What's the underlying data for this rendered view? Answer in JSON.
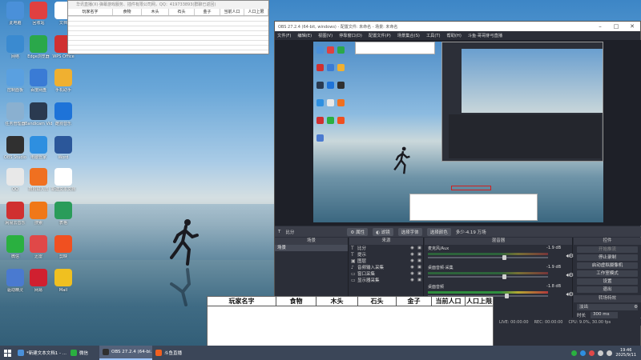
{
  "desktop": {
    "icons": [
      {
        "label": "此电脑",
        "color": "#4a90d9"
      },
      {
        "label": "回收站",
        "color": "#e04040"
      },
      {
        "label": "文档",
        "color": "#ffffff"
      },
      {
        "label": "网络",
        "color": "#3a8ad0"
      },
      {
        "label": "Edge浏览器",
        "color": "#2aa84a"
      },
      {
        "label": "WPS Office",
        "color": "#d03030"
      },
      {
        "label": "控制面板",
        "color": "#5aa0e0"
      },
      {
        "label": "百度网盘",
        "color": "#3a7bd5"
      },
      {
        "label": "手机助手",
        "color": "#f0b030"
      },
      {
        "label": "任务管理器",
        "color": "#8ab0d0"
      },
      {
        "label": "Bandicam Video Editor",
        "color": "#2a3a50"
      },
      {
        "label": "酷狗音乐",
        "color": "#1e73d8"
      },
      {
        "label": "OBS Studio",
        "color": "#303030"
      },
      {
        "label": "电脑管家",
        "color": "#2e8fe0"
      },
      {
        "label": "Word",
        "color": "#2b579a"
      },
      {
        "label": "QQ",
        "color": "#e8e8e8"
      },
      {
        "label": "搜狗输入法",
        "color": "#f07020"
      },
      {
        "label": "新建文本文档",
        "color": "#ffffff"
      },
      {
        "label": "网易云音乐",
        "color": "#d03030"
      },
      {
        "label": "搜索",
        "color": "#f07818"
      },
      {
        "label": "表格",
        "color": "#2a9c5a"
      },
      {
        "label": "微信",
        "color": "#2ab040"
      },
      {
        "label": "迅雷",
        "color": "#e04848"
      },
      {
        "label": "剪映",
        "color": "#f05020"
      },
      {
        "label": "驱动精灵",
        "color": "#4a7ad0"
      },
      {
        "label": "网易",
        "color": "#d02030"
      },
      {
        "label": "Mail",
        "color": "#f0c020"
      }
    ]
  },
  "sheet_window": {
    "title": "华讯直播(X)·弹幕游戏服务、插件有限公司网，QQ：419733893(群聊已返回)",
    "columns": [
      "玩家名字",
      "食物",
      "木头",
      "石头",
      "金子",
      "当前人口",
      "人口上限"
    ]
  },
  "obs": {
    "title": "OBS 27.2.4 (64-bit, windows) - 配置文件: 未命名 - 场景: 未命名",
    "window_buttons": {
      "minimize": "–",
      "maximize": "□",
      "close": "✕"
    },
    "menu": [
      "文件(F)",
      "编辑(E)",
      "视图(V)",
      "停靠窗口(D)",
      "配置文件(P)",
      "场景集合(S)",
      "工具(T)",
      "帮助(H)",
      "斗鱼·哥哥芽弓直播"
    ],
    "source_toolbar": {
      "current_source": "比分",
      "properties": "属性",
      "filters": "滤镜",
      "select_font": "选择字体",
      "select_color": "选择颜色",
      "text_content": "多少-4.19 万场"
    },
    "scenes": {
      "header": "场景",
      "items": [
        "场景"
      ]
    },
    "sources": {
      "header": "来源",
      "items": [
        {
          "icon": "T",
          "label": "比分"
        },
        {
          "icon": "T",
          "label": "提示"
        },
        {
          "icon": "▣",
          "label": "图层"
        },
        {
          "icon": "♪",
          "label": "音频输入采集"
        },
        {
          "icon": "▭",
          "label": "窗口采集"
        },
        {
          "icon": "▭",
          "label": "显示器采集"
        }
      ]
    },
    "mixer": {
      "header": "混音器",
      "channels": [
        {
          "name": "麦克风/Aux",
          "db": "-1.9 dB",
          "level": 0.0,
          "volume": 0.62
        },
        {
          "name": "桌面音频·采集",
          "db": "-1.9 dB",
          "level": 0.0,
          "volume": 0.62
        },
        {
          "name": "桌面音频",
          "db": "-1.8 dB",
          "level": 0.68,
          "volume": 0.64
        }
      ]
    },
    "controls": {
      "header": "控件",
      "buttons": [
        "开始推流",
        "停止录制",
        "启动虚拟摄像机",
        "工作室模式",
        "设置",
        "退出"
      ]
    },
    "transitions": {
      "header": "转场特效",
      "selected": "淡出",
      "duration_label": "时长",
      "duration_value": "300 ms"
    },
    "status": {
      "live": "LIVE: 00:00:00",
      "rec": "REC: 00:00:00",
      "cpu": "CPU: 9.0%, 30.00 fps"
    }
  },
  "bottom_table": {
    "columns": [
      "玩家名字",
      "食物",
      "木头",
      "石头",
      "金子",
      "当前人口",
      "人口上限"
    ]
  },
  "taskbar": {
    "items": [
      {
        "label": "*新建文本文档1 - ...",
        "color": "#4a90d9",
        "active": false
      },
      {
        "label": "微信",
        "color": "#2ab040",
        "active": false
      },
      {
        "label": "OBS 27.2.4 (64-bi...",
        "color": "#303030",
        "active": true
      },
      {
        "label": "斗鱼直播",
        "color": "#f06020",
        "active": false
      }
    ],
    "tray_icons": [
      {
        "name": "wechat",
        "color": "#2ab040"
      },
      {
        "name": "browser",
        "color": "#2e8fe0"
      },
      {
        "name": "antivirus",
        "color": "#e04848"
      },
      {
        "name": "network",
        "color": "#cccccc"
      },
      {
        "name": "volume",
        "color": "#cccccc"
      }
    ],
    "time": "19:46",
    "date": "2025/9/11"
  }
}
